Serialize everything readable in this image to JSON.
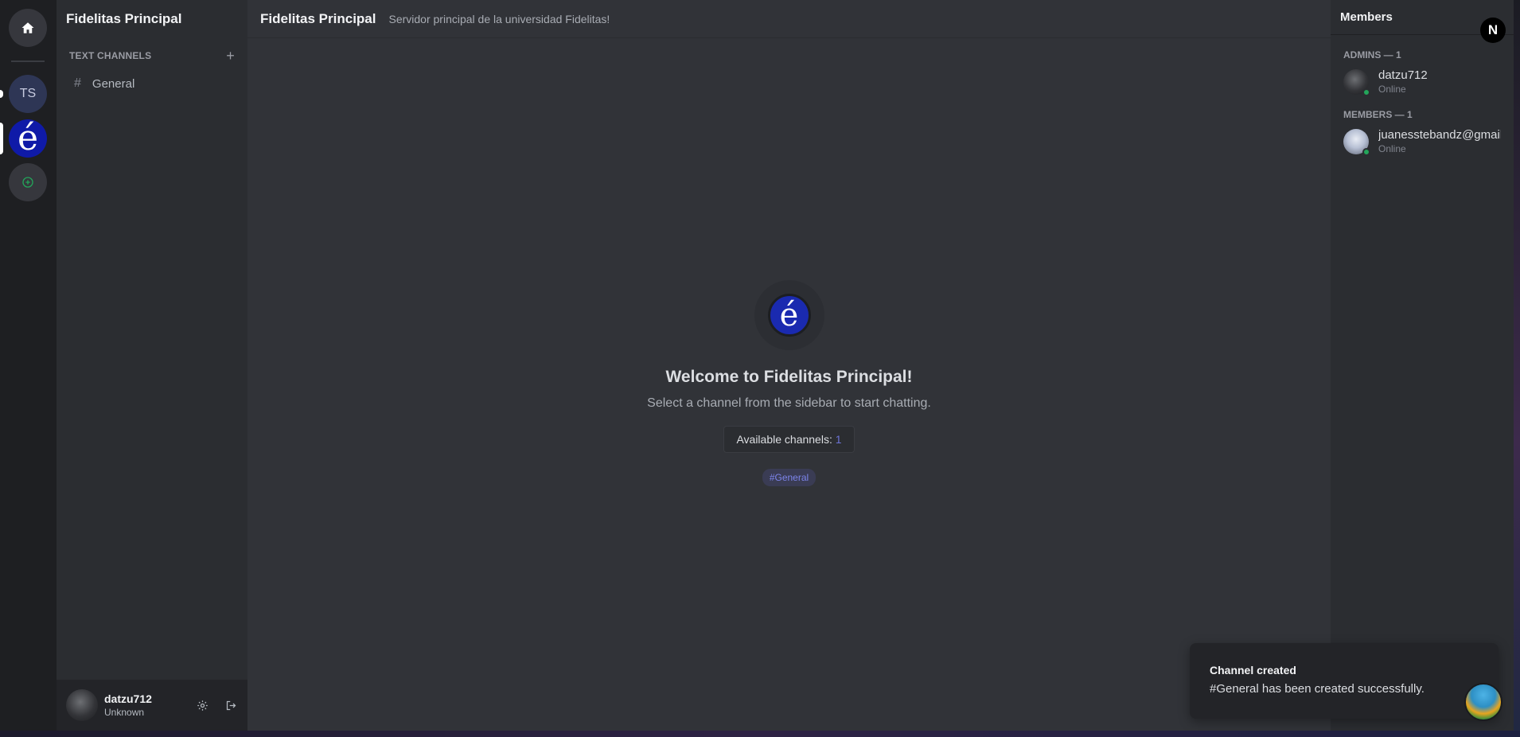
{
  "rail": {
    "home_icon": "home-icon",
    "ts_label": "TS",
    "fidelitas_label": "é",
    "add_icon": "plus-circle-icon"
  },
  "sidebar": {
    "server_name": "Fidelitas Principal",
    "category": "TEXT CHANNELS",
    "channels": [
      {
        "label": "General"
      }
    ]
  },
  "user": {
    "name": "datzu712",
    "status": "Unknown"
  },
  "header": {
    "title": "Fidelitas Principal",
    "subtitle": "Servidor principal de la universidad Fidelitas!"
  },
  "welcome": {
    "logo": "é",
    "title": "Welcome to Fidelitas Principal!",
    "hint": "Select a channel from the sidebar to start chatting.",
    "channels_label": "Available channels:",
    "channels_count": "1",
    "tag": "#General"
  },
  "members": {
    "title": "Members",
    "badge": "N",
    "admins_label": "ADMINS — 1",
    "members_label": "MEMBERS — 1",
    "admins": [
      {
        "name": "datzu712",
        "status": "Online"
      }
    ],
    "members": [
      {
        "name": "juanesstebandz@gmail.com",
        "status": "Online"
      }
    ]
  },
  "toast": {
    "title": "Channel created",
    "body": "#General has been created successfully."
  },
  "colors": {
    "accent": "#5865f2",
    "online": "#23a55a",
    "fidelitas_blue": "#0f1aa8"
  }
}
